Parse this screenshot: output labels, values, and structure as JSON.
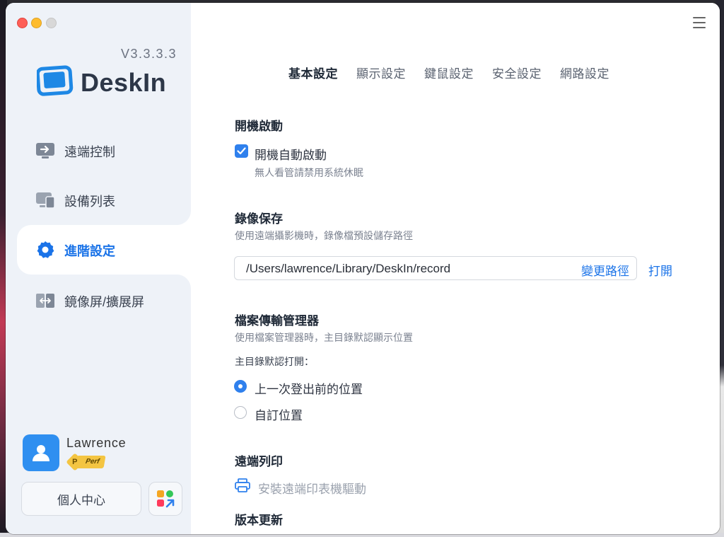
{
  "app": {
    "version": "V3.3.3.3",
    "name": "DeskIn"
  },
  "sidebar": {
    "items": [
      {
        "label": "遠端控制",
        "icon": "remote-control-icon"
      },
      {
        "label": "設備列表",
        "icon": "devices-icon"
      },
      {
        "label": "進階設定",
        "icon": "gear-icon",
        "active": true
      },
      {
        "label": "鏡像屏/擴展屏",
        "icon": "mirror-screen-icon"
      }
    ],
    "user": {
      "name": "Lawrence",
      "badge_letter": "P",
      "badge_text": "Perf"
    },
    "profile_button": "個人中心"
  },
  "tabs": [
    {
      "label": "基本設定",
      "active": true
    },
    {
      "label": "顯示設定"
    },
    {
      "label": "鍵鼠設定"
    },
    {
      "label": "安全設定"
    },
    {
      "label": "網路設定"
    }
  ],
  "settings": {
    "startup": {
      "title": "開機啟動",
      "checkbox_label": "開機自動啟動",
      "checked": true,
      "hint": "無人看管請禁用系統休眠"
    },
    "recording": {
      "title": "錄像保存",
      "desc": "使用遠端攝影機時，錄像檔預設儲存路徑",
      "path": "/Users/lawrence/Library/DeskIn/record",
      "change_label": "變更路徑",
      "open_label": "打開"
    },
    "file_manager": {
      "title": "檔案傳輸管理器",
      "desc": "使用檔案管理器時，主目錄默認顯示位置",
      "option_label": "主目錄默認打開：",
      "options": [
        {
          "label": "上一次登出前的位置",
          "selected": true
        },
        {
          "label": "自訂位置",
          "selected": false
        }
      ]
    },
    "remote_print": {
      "title": "遠端列印",
      "install_label": "安裝遠端印表機驅動"
    },
    "update": {
      "title": "版本更新"
    }
  },
  "colors": {
    "accent": "#1a73e8",
    "sidebar_bg": "#eef2f8",
    "badge": "#f4c542"
  }
}
